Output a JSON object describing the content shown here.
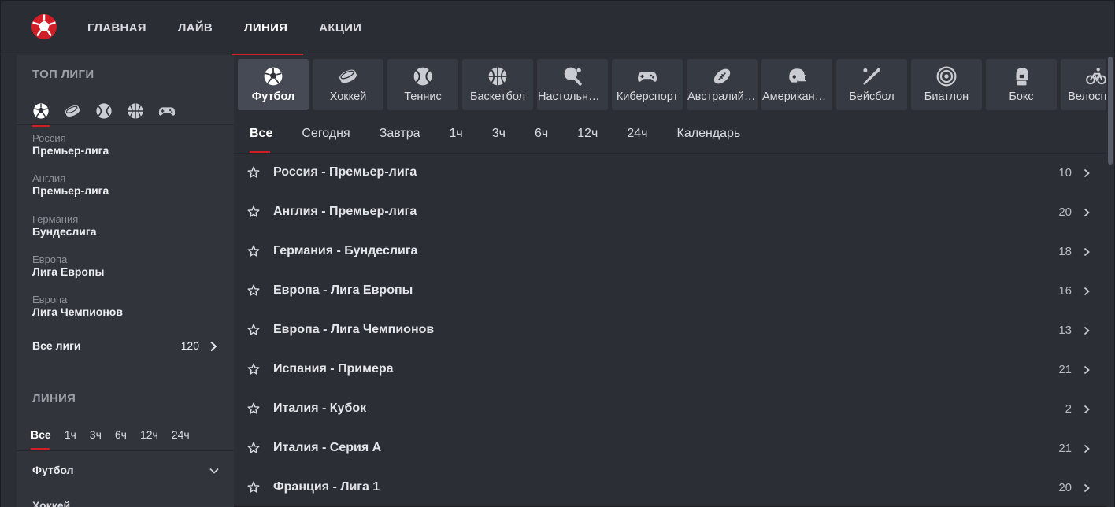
{
  "header": {
    "logo": "football-logo",
    "nav": [
      {
        "label": "ГЛАВНАЯ",
        "active": false
      },
      {
        "label": "ЛАЙВ",
        "active": false
      },
      {
        "label": "ЛИНИЯ",
        "active": true
      },
      {
        "label": "АКЦИИ",
        "active": false
      }
    ]
  },
  "sidebar": {
    "top_title": "ТОП ЛИГИ",
    "sport_icons": [
      "soccer-ball-icon",
      "hockey-puck-icon",
      "tennis-ball-icon",
      "basketball-icon",
      "gamepad-icon"
    ],
    "leagues": [
      {
        "country": "Россия",
        "name": "Премьер-лига"
      },
      {
        "country": "Англия",
        "name": "Премьер-лига"
      },
      {
        "country": "Германия",
        "name": "Бундеслига"
      },
      {
        "country": "Европа",
        "name": "Лига Европы"
      },
      {
        "country": "Европа",
        "name": "Лига Чемпионов"
      }
    ],
    "all_leagues": {
      "label": "Все лиги",
      "count": "120"
    },
    "line_title": "ЛИНИЯ",
    "filters": [
      {
        "label": "Все",
        "active": true
      },
      {
        "label": "1ч",
        "active": false
      },
      {
        "label": "3ч",
        "active": false
      },
      {
        "label": "6ч",
        "active": false
      },
      {
        "label": "12ч",
        "active": false
      },
      {
        "label": "24ч",
        "active": false
      }
    ],
    "sport_group": "Футбол",
    "next_group_partial": "Хоккей"
  },
  "sports": [
    {
      "label": "Футбол",
      "icon": "soccer-ball-icon",
      "active": true
    },
    {
      "label": "Хоккей",
      "icon": "hockey-puck-icon"
    },
    {
      "label": "Теннис",
      "icon": "tennis-ball-icon"
    },
    {
      "label": "Баскетбол",
      "icon": "basketball-icon"
    },
    {
      "label": "Настольный теннис",
      "icon": "table-tennis-icon"
    },
    {
      "label": "Киберспорт",
      "icon": "gamepad-icon"
    },
    {
      "label": "Австралийский футбол",
      "icon": "rugby-ball-icon"
    },
    {
      "label": "Американский футбол",
      "icon": "football-helmet-icon"
    },
    {
      "label": "Бейсбол",
      "icon": "baseball-bat-icon"
    },
    {
      "label": "Биатлон",
      "icon": "target-icon"
    },
    {
      "label": "Бокс",
      "icon": "boxing-glove-icon"
    },
    {
      "label": "Велоспорт",
      "icon": "bicycle-icon"
    }
  ],
  "time_tabs": [
    {
      "label": "Все",
      "active": true
    },
    {
      "label": "Сегодня"
    },
    {
      "label": "Завтра"
    },
    {
      "label": "1ч"
    },
    {
      "label": "3ч"
    },
    {
      "label": "6ч"
    },
    {
      "label": "12ч"
    },
    {
      "label": "24ч"
    },
    {
      "label": "Календарь"
    }
  ],
  "league_rows": [
    {
      "name": "Россия - Премьер-лига",
      "count": "10"
    },
    {
      "name": "Англия - Премьер-лига",
      "count": "20"
    },
    {
      "name": "Германия - Бундеслига",
      "count": "18"
    },
    {
      "name": "Европа - Лига Европы",
      "count": "16"
    },
    {
      "name": "Европа - Лига Чемпионов",
      "count": "13"
    },
    {
      "name": "Испания - Примера",
      "count": "21"
    },
    {
      "name": "Италия - Кубок",
      "count": "2"
    },
    {
      "name": "Италия - Серия А",
      "count": "21"
    },
    {
      "name": "Франция - Лига 1",
      "count": "20"
    }
  ],
  "colors": {
    "accent": "#d01e26",
    "background": "#2b2e35",
    "sidebar": "#31343b",
    "tile": "#363a42"
  }
}
